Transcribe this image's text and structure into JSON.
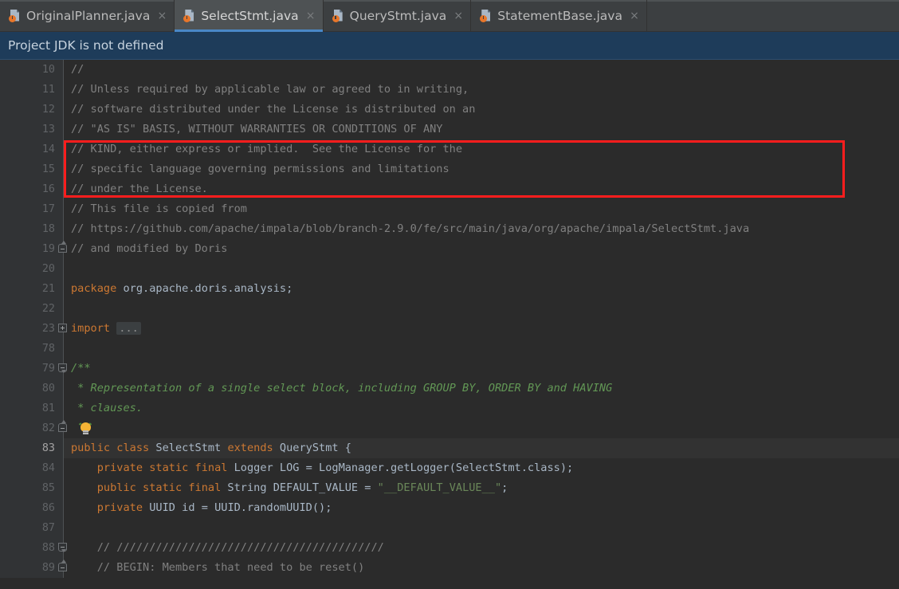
{
  "window": {
    "accent_blue": "#4a88c7",
    "editor_bg": "#2b2b2b",
    "gutter_bg": "#313335",
    "tabbar_bg": "#3c3f41",
    "notif_bg": "#1e3c5a",
    "annotation_color": "#fc1d1d"
  },
  "tabs": [
    {
      "label": "OriginalPlanner.java",
      "icon": "java-file-icon",
      "close": "×",
      "active": false
    },
    {
      "label": "SelectStmt.java",
      "icon": "java-file-icon",
      "close": "×",
      "active": true
    },
    {
      "label": "QueryStmt.java",
      "icon": "java-file-icon",
      "close": "×",
      "active": false
    },
    {
      "label": "StatementBase.java",
      "icon": "java-file-icon",
      "close": "×",
      "active": false
    }
  ],
  "notification": {
    "text": "Project JDK is not defined"
  },
  "editor": {
    "file": "SelectStmt.java",
    "current_line": 83,
    "lines": [
      {
        "num": "10",
        "indent": 0,
        "fold": null,
        "current": false,
        "tokens": [
          {
            "t": "//",
            "c": "cm"
          }
        ]
      },
      {
        "num": "11",
        "indent": 0,
        "fold": null,
        "current": false,
        "tokens": [
          {
            "t": "// Unless required by applicable law or agreed to in writing,",
            "c": "cm"
          }
        ]
      },
      {
        "num": "12",
        "indent": 0,
        "fold": null,
        "current": false,
        "tokens": [
          {
            "t": "// software distributed under the License is distributed on an",
            "c": "cm"
          }
        ]
      },
      {
        "num": "13",
        "indent": 0,
        "fold": null,
        "current": false,
        "tokens": [
          {
            "t": "// \"AS IS\" BASIS, WITHOUT WARRANTIES OR CONDITIONS OF ANY",
            "c": "cm"
          }
        ]
      },
      {
        "num": "14",
        "indent": 0,
        "fold": null,
        "current": false,
        "tokens": [
          {
            "t": "// KIND, either express or implied.  See the License for the",
            "c": "cm"
          }
        ]
      },
      {
        "num": "15",
        "indent": 0,
        "fold": null,
        "current": false,
        "tokens": [
          {
            "t": "// specific language governing permissions and limitations",
            "c": "cm"
          }
        ]
      },
      {
        "num": "16",
        "indent": 0,
        "fold": null,
        "current": false,
        "tokens": [
          {
            "t": "// under the License.",
            "c": "cm"
          }
        ]
      },
      {
        "num": "17",
        "indent": 0,
        "fold": null,
        "current": false,
        "tokens": [
          {
            "t": "// This file is copied from",
            "c": "cm"
          }
        ]
      },
      {
        "num": "18",
        "indent": 0,
        "fold": null,
        "current": false,
        "tokens": [
          {
            "t": "// https://github.com/apache/impala/blob/branch-2.9.0/fe/src/main/java/org/apache/impala/SelectStmt.java",
            "c": "cm"
          }
        ]
      },
      {
        "num": "19",
        "indent": 0,
        "fold": "bot",
        "current": false,
        "tokens": [
          {
            "t": "// and modified by Doris",
            "c": "cm"
          }
        ]
      },
      {
        "num": "20",
        "indent": 0,
        "fold": null,
        "current": false,
        "tokens": []
      },
      {
        "num": "21",
        "indent": 0,
        "fold": null,
        "current": false,
        "tokens": [
          {
            "t": "package",
            "c": "kw"
          },
          {
            "t": " org.apache.doris.analysis;",
            "c": "id"
          }
        ]
      },
      {
        "num": "22",
        "indent": 0,
        "fold": null,
        "current": false,
        "tokens": []
      },
      {
        "num": "23",
        "indent": 0,
        "fold": "plus",
        "current": false,
        "tokens": [
          {
            "t": "import",
            "c": "kw"
          },
          {
            "t": " ",
            "c": "id"
          },
          {
            "t": "...",
            "c": "fld"
          }
        ]
      },
      {
        "num": "78",
        "indent": 0,
        "fold": null,
        "current": false,
        "tokens": []
      },
      {
        "num": "79",
        "indent": 0,
        "fold": "top",
        "current": false,
        "tokens": [
          {
            "t": "/**",
            "c": "jd"
          }
        ]
      },
      {
        "num": "80",
        "indent": 0,
        "fold": null,
        "current": false,
        "tokens": [
          {
            "t": " * Representation of a single select block, including GROUP BY, ORDER BY and HAVING",
            "c": "jd"
          }
        ]
      },
      {
        "num": "81",
        "indent": 0,
        "fold": null,
        "current": false,
        "tokens": [
          {
            "t": " * clauses.",
            "c": "jd"
          }
        ]
      },
      {
        "num": "82",
        "indent": 0,
        "fold": "bot",
        "current": false,
        "bulb": true,
        "tokens": []
      },
      {
        "num": "83",
        "indent": 0,
        "fold": null,
        "current": true,
        "tokens": [
          {
            "t": "public",
            "c": "kw"
          },
          {
            "t": " ",
            "c": "id"
          },
          {
            "t": "class",
            "c": "kw"
          },
          {
            "t": " SelectStmt ",
            "c": "id"
          },
          {
            "t": "extends",
            "c": "kw"
          },
          {
            "t": " QueryStmt {",
            "c": "id"
          }
        ]
      },
      {
        "num": "84",
        "indent": 0,
        "fold": null,
        "current": false,
        "tokens": [
          {
            "t": "    ",
            "c": "id"
          },
          {
            "t": "private static final",
            "c": "kw"
          },
          {
            "t": " Logger LOG = LogManager.getLogger(SelectStmt.class);",
            "c": "id"
          }
        ]
      },
      {
        "num": "85",
        "indent": 0,
        "fold": null,
        "current": false,
        "tokens": [
          {
            "t": "    ",
            "c": "id"
          },
          {
            "t": "public static final",
            "c": "kw"
          },
          {
            "t": " String DEFAULT_VALUE = ",
            "c": "id"
          },
          {
            "t": "\"__DEFAULT_VALUE__\"",
            "c": "st"
          },
          {
            "t": ";",
            "c": "id"
          }
        ]
      },
      {
        "num": "86",
        "indent": 0,
        "fold": null,
        "current": false,
        "tokens": [
          {
            "t": "    ",
            "c": "id"
          },
          {
            "t": "private",
            "c": "kw"
          },
          {
            "t": " UUID id = UUID.randomUUID();",
            "c": "id"
          }
        ]
      },
      {
        "num": "87",
        "indent": 0,
        "fold": null,
        "current": false,
        "tokens": []
      },
      {
        "num": "88",
        "indent": 0,
        "fold": "top",
        "current": false,
        "tokens": [
          {
            "t": "    // /////////////////////////////////////////",
            "c": "cm"
          }
        ]
      },
      {
        "num": "89",
        "indent": 0,
        "fold": "bot",
        "current": false,
        "tokens": [
          {
            "t": "    // BEGIN: Members that need to be reset()",
            "c": "cm"
          }
        ]
      }
    ]
  },
  "annotation": {
    "type": "red-rectangle-highlight",
    "covers_lines": "17-19"
  }
}
